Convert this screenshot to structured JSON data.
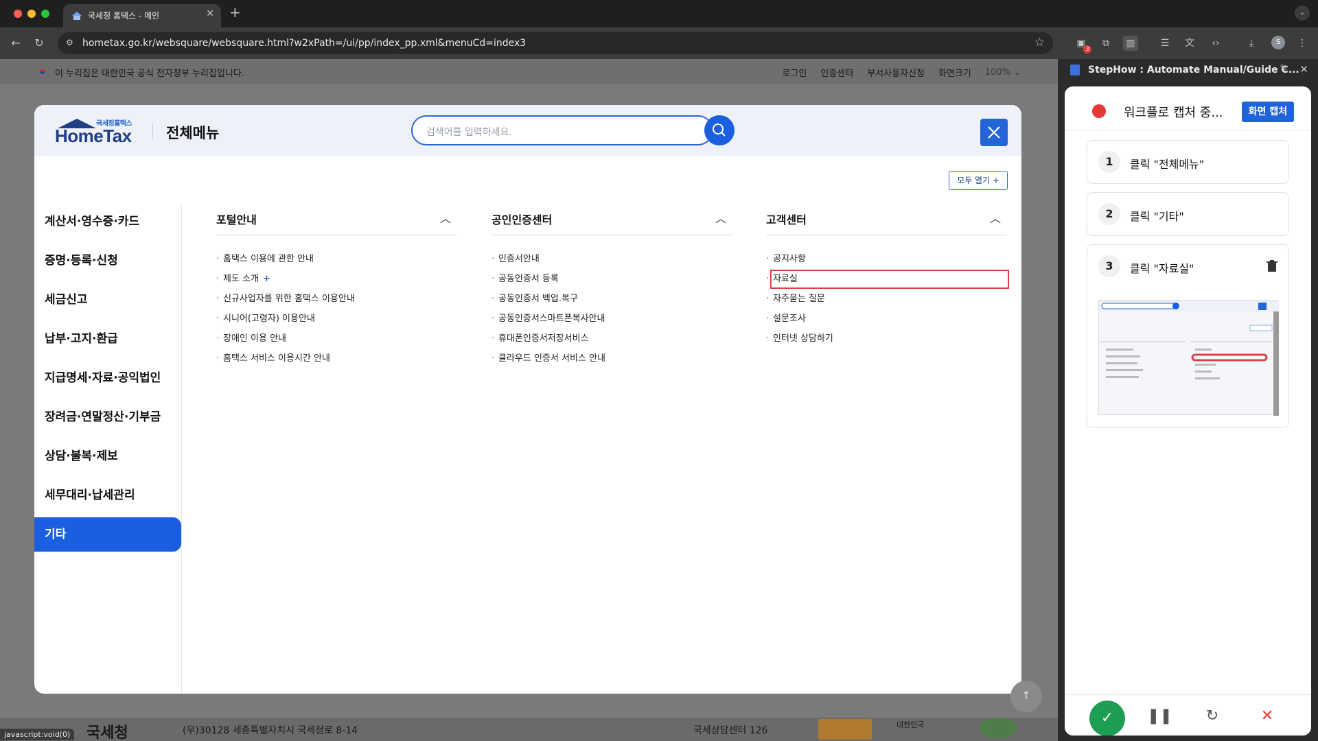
{
  "browser": {
    "tab_title": "국세청 홈택스 - 메인",
    "url": "hometax.go.kr/websquare/websquare.html?w2xPath=/ui/pp/index_pp.xml&menuCd=index3",
    "extension_badge": "3",
    "profile_initial": "S",
    "status_text": "javascript:void(0)"
  },
  "govbar": {
    "notice": "이 누리집은 대한민국 공식 전자정부 누리집입니다.",
    "links": [
      "로그인",
      "인증센터",
      "부서사용자신청",
      "화면크기"
    ],
    "zoom": "100%"
  },
  "modal": {
    "logo_sub": "국세청홈택스",
    "logo_main": "HomeTax",
    "title": "전체메뉴",
    "search_placeholder": "검색어를 입력하세요.",
    "open_all": "모두 열기 +",
    "nav": [
      {
        "label": "계산서·영수증·카드",
        "active": false
      },
      {
        "label": "증명·등록·신청",
        "active": false
      },
      {
        "label": "세금신고",
        "active": false
      },
      {
        "label": "납부·고지·환급",
        "active": false
      },
      {
        "label": "지급명세·자료·공익법인",
        "active": false
      },
      {
        "label": "장려금·연말정산·기부금",
        "active": false
      },
      {
        "label": "상담·불복·제보",
        "active": false
      },
      {
        "label": "세무대리·납세관리",
        "active": false
      },
      {
        "label": "기타",
        "active": true
      }
    ],
    "columns": [
      {
        "title": "포털안내",
        "items": [
          "홈택스 이용에 관한 안내",
          "제도 소개",
          "신규사업자를 위한 홈택스 이용안내",
          "시니어(고령자) 이용안내",
          "장애인 이용 안내",
          "홈택스 서비스 이용시간 안내"
        ]
      },
      {
        "title": "공인인증센터",
        "items": [
          "인증서안내",
          "공동인증서 등록",
          "공동인증서 백업.복구",
          "공동인증서스마트폰복사안내",
          "휴대폰인증서저장서비스",
          "클라우드 인증서 서비스 안내"
        ]
      },
      {
        "title": "고객센터",
        "items": [
          "공지사항",
          "자료실",
          "자주묻는 질문",
          "설문조사",
          "인터넷 상담하기"
        ]
      }
    ]
  },
  "footer": {
    "org": "국세청",
    "address": "(우)30128 세종특별자치시 국세청로 8-14",
    "tel": "국세상담센터 126",
    "logo_text": "대한민국"
  },
  "side_panel": {
    "title": "StepHow : Automate Manual/Guide C...",
    "recording_text": "워크플로 캡처 중...",
    "capture_button": "화면 캡처",
    "steps": [
      {
        "num": "1",
        "label": "클릭 \"전체메뉴\""
      },
      {
        "num": "2",
        "label": "클릭 \"기타\""
      },
      {
        "num": "3",
        "label": "클릭 \"자료실\""
      }
    ],
    "colors": {
      "record": "#e53935",
      "done": "#1e9e54",
      "cancel": "#e53935",
      "accent": "#1f63d9"
    }
  }
}
